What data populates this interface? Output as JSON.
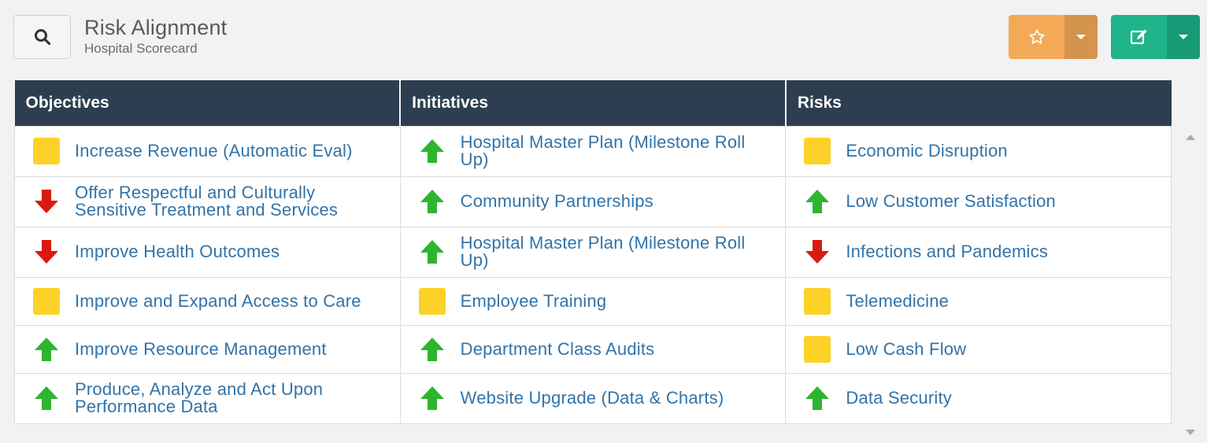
{
  "header": {
    "title": "Risk Alignment",
    "subtitle": "Hospital Scorecard"
  },
  "colors": {
    "header_bg": "#2d3e50",
    "link": "#3273a8",
    "status_up": "#2db52d",
    "status_down": "#d81b10",
    "status_neutral": "#fcd228",
    "favorite_button": "#f4a957",
    "edit_button": "#1fb48a"
  },
  "table": {
    "columns": [
      "Objectives",
      "Initiatives",
      "Risks"
    ],
    "rows": [
      [
        {
          "status": "neutral",
          "label": "Increase Revenue (Automatic Eval)"
        },
        {
          "status": "up",
          "label": "Hospital Master Plan (Milestone Roll Up)"
        },
        {
          "status": "neutral",
          "label": "Economic Disruption"
        }
      ],
      [
        {
          "status": "down",
          "label": "Offer Respectful and Culturally Sensitive Treatment and Services"
        },
        {
          "status": "up",
          "label": "Community Partnerships"
        },
        {
          "status": "up",
          "label": "Low Customer Satisfaction"
        }
      ],
      [
        {
          "status": "down",
          "label": "Improve Health Outcomes"
        },
        {
          "status": "up",
          "label": "Hospital Master Plan (Milestone Roll Up)"
        },
        {
          "status": "down",
          "label": "Infections and Pandemics"
        }
      ],
      [
        {
          "status": "neutral",
          "label": "Improve and Expand Access to Care"
        },
        {
          "status": "neutral",
          "label": "Employee Training"
        },
        {
          "status": "neutral",
          "label": "Telemedicine"
        }
      ],
      [
        {
          "status": "up",
          "label": "Improve Resource Management"
        },
        {
          "status": "up",
          "label": "Department Class Audits"
        },
        {
          "status": "neutral",
          "label": "Low Cash Flow"
        }
      ],
      [
        {
          "status": "up",
          "label": "Produce, Analyze and Act Upon Performance Data"
        },
        {
          "status": "up",
          "label": "Website Upgrade (Data & Charts)"
        },
        {
          "status": "up",
          "label": "Data Security"
        }
      ]
    ]
  }
}
